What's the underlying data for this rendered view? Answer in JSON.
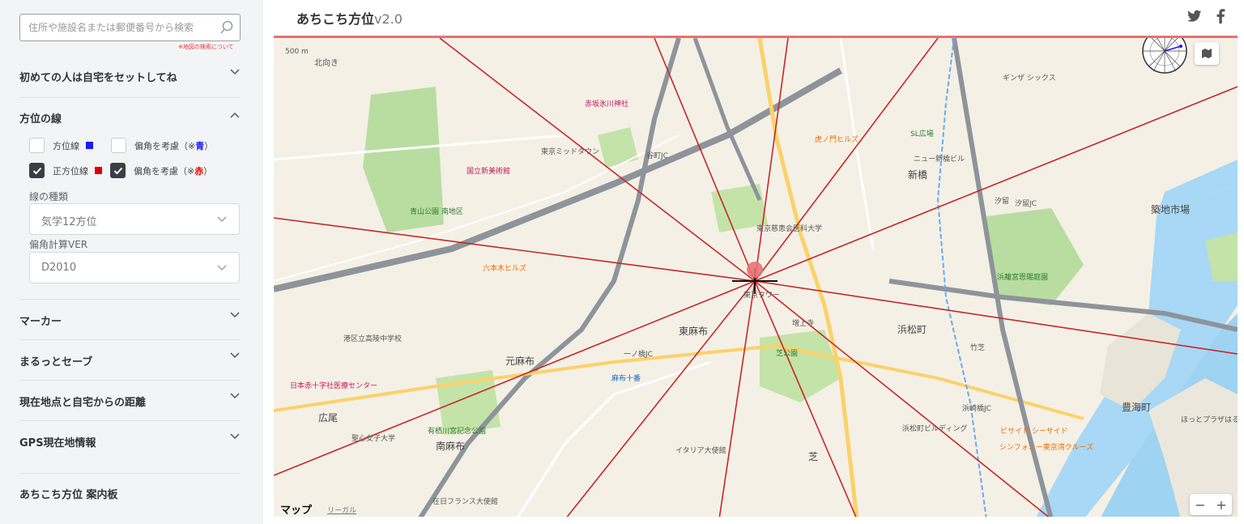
{
  "search": {
    "placeholder": "住所や施設名または郵便番号から検索",
    "note": "※地図の検索について"
  },
  "sections": {
    "home": "初めての人は自宅をセットしてね",
    "lines": {
      "title": "方位の線",
      "row1": {
        "label": "方位線",
        "color": "#1a1aff",
        "decl_label": "偏角を考慮（※",
        "decl_mark": "青",
        "decl_end": "）",
        "mark_color": "#1a1aff"
      },
      "row2": {
        "label": "正方位線",
        "color": "#e00000",
        "decl_label": "偏角を考慮（※",
        "decl_mark": "赤",
        "decl_end": "）",
        "mark_color": "#e00000"
      },
      "kind_label": "線の種類",
      "kind_value": "気学12方位",
      "ver_label": "偏角計算VER",
      "ver_value": "D2010"
    },
    "marker": "マーカー",
    "save": "まるっとセーブ",
    "distance": "現在地点と自宅からの距離",
    "gps": "GPS現在地情報",
    "board": "あちこち方位 案内板"
  },
  "header": {
    "title": "あちこち方位",
    "version": "v2.0"
  },
  "map": {
    "scale": "500 m",
    "north": "北向き",
    "brand": "マップ",
    "legal": "リーガル",
    "zoom_out": "−",
    "zoom_in": "+",
    "labels": {
      "l1": "東麻布",
      "l2": "元麻布",
      "l3": "南麻布",
      "l4": "広尾",
      "l5": "新橋",
      "l6": "浜松町",
      "l7": "築地市場",
      "l8": "芝",
      "l9": "豊海町",
      "l10": "六本木ヒルズ",
      "l11": "虎ノ門ヒルズ",
      "l12": "東京ミッドタウン",
      "l13": "国立新美術館",
      "l14": "青山公園 南地区",
      "l15": "東京タワー",
      "l16": "増上寺",
      "l17": "芝公園",
      "l18": "浜離宮恩賜庭園",
      "l19": "竹芝",
      "l20": "汐留",
      "l21": "SL広場",
      "l22": "ギンザ シックス",
      "l23": "港区立高陵中学校",
      "l24": "日本赤十字社医療センター",
      "l25": "有栖川宮記念公園",
      "l26": "聖心女子大学",
      "l27": "麻布十番",
      "l28": "赤坂氷川神社",
      "l29": "一ノ橋JC",
      "l30": "浜崎橋JC",
      "l31": "谷町JC",
      "l32": "汐留JC",
      "l33": "ニュー新橋ビル",
      "l34": "シンフォニー東京湾クルーズ",
      "l35": "ビサイド シーサイド",
      "l36": "イタリア大使館",
      "l37": "在日フランス大使館",
      "l38": "東京慈恵会医科大学",
      "l39": "浜松町ビルディング",
      "l40": "ほっとプラザはるみ"
    }
  },
  "icons": {
    "search": "search-icon",
    "twitter": "twitter-icon",
    "facebook": "facebook-icon",
    "compass": "compass-icon",
    "map_type": "map-type-icon"
  }
}
